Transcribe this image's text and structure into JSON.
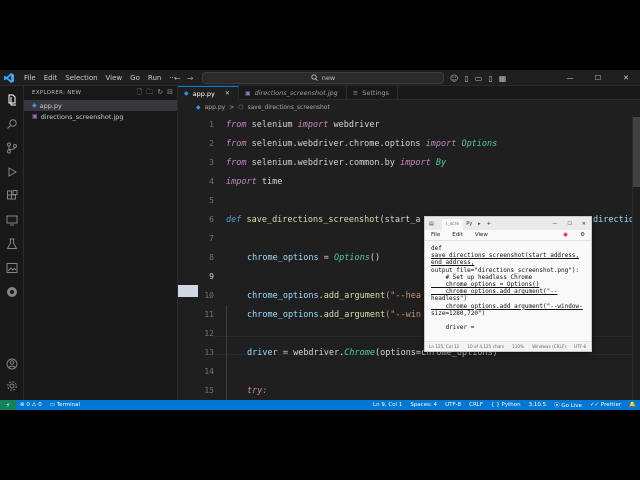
{
  "menu": [
    "File",
    "Edit",
    "Selection",
    "View",
    "Go",
    "Run"
  ],
  "more_menu": "···",
  "search": {
    "text": "new"
  },
  "sidebar": {
    "title": "EXPLORER: NEW",
    "files": [
      {
        "name": "app.py",
        "type": "py"
      },
      {
        "name": "directions_screenshot.jpg",
        "type": "image"
      }
    ]
  },
  "tabs": [
    {
      "label": "app.py",
      "active": true
    },
    {
      "label": "directions_screenshot.jpg",
      "active": false
    },
    {
      "label": "Settings",
      "active": false
    }
  ],
  "breadcrumb": {
    "file": "app.py",
    "separator": ">",
    "symbol": "save_directions_screenshot"
  },
  "editor": {
    "line_numbers": [
      "1",
      "2",
      "3",
      "4",
      "5",
      "6",
      "7",
      "8",
      "9",
      "10",
      "11",
      "12",
      "13",
      "14",
      "15"
    ],
    "current_line": "9",
    "lines": {
      "l1": {
        "kw": "from",
        "mod": " selenium ",
        "kw2": "import",
        "name": " webdriver"
      },
      "l2": {
        "kw": "from",
        "mod": " selenium.webdriver.chrome.options ",
        "kw2": "import",
        "name": " Options"
      },
      "l3": {
        "kw": "from",
        "mod": " selenium.webdriver.common.by ",
        "kw2": "import",
        "name": " By"
      },
      "l4": {
        "kw": "import",
        "name": " time"
      },
      "l6": {
        "kw": "def",
        "fn": " save_directions_screenshot",
        "rest": "(start_a",
        "tail": "direction"
      },
      "l8": {
        "var": "chrome_options",
        "op": " = ",
        "cls": "Options",
        "rest": "()"
      },
      "l10": {
        "var": "chrome_options",
        "fn": ".add_argument",
        "rest": "(\"--hea"
      },
      "l11": {
        "var": "chrome_options",
        "fn": ".add_argument",
        "rest": "(\"--win"
      },
      "l13": {
        "var": "driver",
        "op": " = ",
        "mod": "webdriver.",
        "cls": "Chrome",
        "rest": "(options=chrome_options)"
      },
      "l15": {
        "kw": "try:"
      }
    }
  },
  "status": {
    "errors": "0",
    "warnings": "0",
    "terminal": "Terminal",
    "position": "Ln 9, Col 1",
    "spaces": "Spaces: 4",
    "encoding": "UTF-8",
    "eol": "CRLF",
    "language": "Python",
    "version": "3.10.5",
    "golive": "Go Live",
    "prettier": "Prettier"
  },
  "notepad": {
    "tab_label": "r_scre",
    "tab_label_2": "Py",
    "menu": [
      "File",
      "Edit",
      "View"
    ],
    "content": {
      "l1": "def",
      "l2": "save_directions_screenshot(start_address,",
      "l3": "end_address,",
      "l4": "output_file=\"directions_screenshot.png\"):",
      "l5": "    # Set up headless Chrome",
      "l6": "    chrome_options = Options()",
      "l7": "    chrome_options.add_argument(\"--",
      "l8": "headless\")",
      "l9": "    chrome_options.add_argument(\"--window-",
      "l10": "size=1280,720\")",
      "l11": "",
      "l12": "    driver ="
    },
    "status": {
      "position": "Ln 125, Col 12",
      "chars": "10 of 4,125 chars",
      "zoom": "110%",
      "eol": "Windows (CRLF)",
      "encoding": "UTF-8"
    }
  }
}
